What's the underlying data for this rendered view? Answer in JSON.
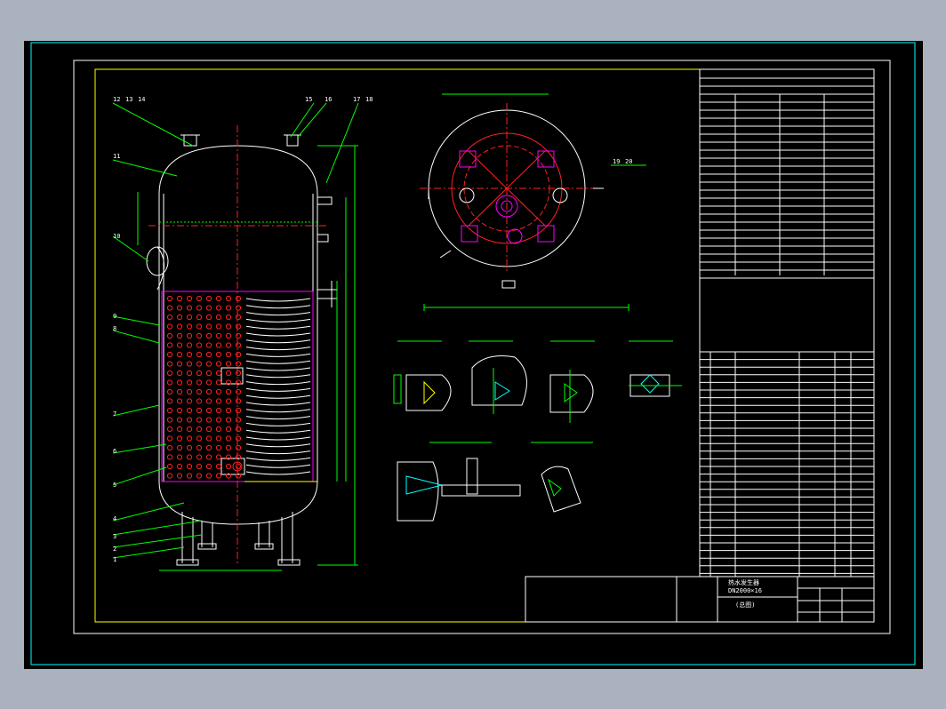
{
  "drawing": {
    "part_numbers": [
      "12",
      "13",
      "14",
      "15",
      "16",
      "17",
      "18",
      "11",
      "10",
      "9",
      "8",
      "7",
      "6",
      "5",
      "4",
      "3",
      "2",
      "1",
      "19",
      "20"
    ],
    "title_block": {
      "product_name": "热水发生器",
      "spec": "DN2000×16",
      "view_name": "(总图)"
    },
    "colors": {
      "background": "#000000",
      "frame": "#ffff00",
      "outline": "#ffffff",
      "dimension": "#00ff00",
      "center_line": "#ff2020",
      "heater_coil": "#ff00ff",
      "border": "#00ffff"
    }
  }
}
